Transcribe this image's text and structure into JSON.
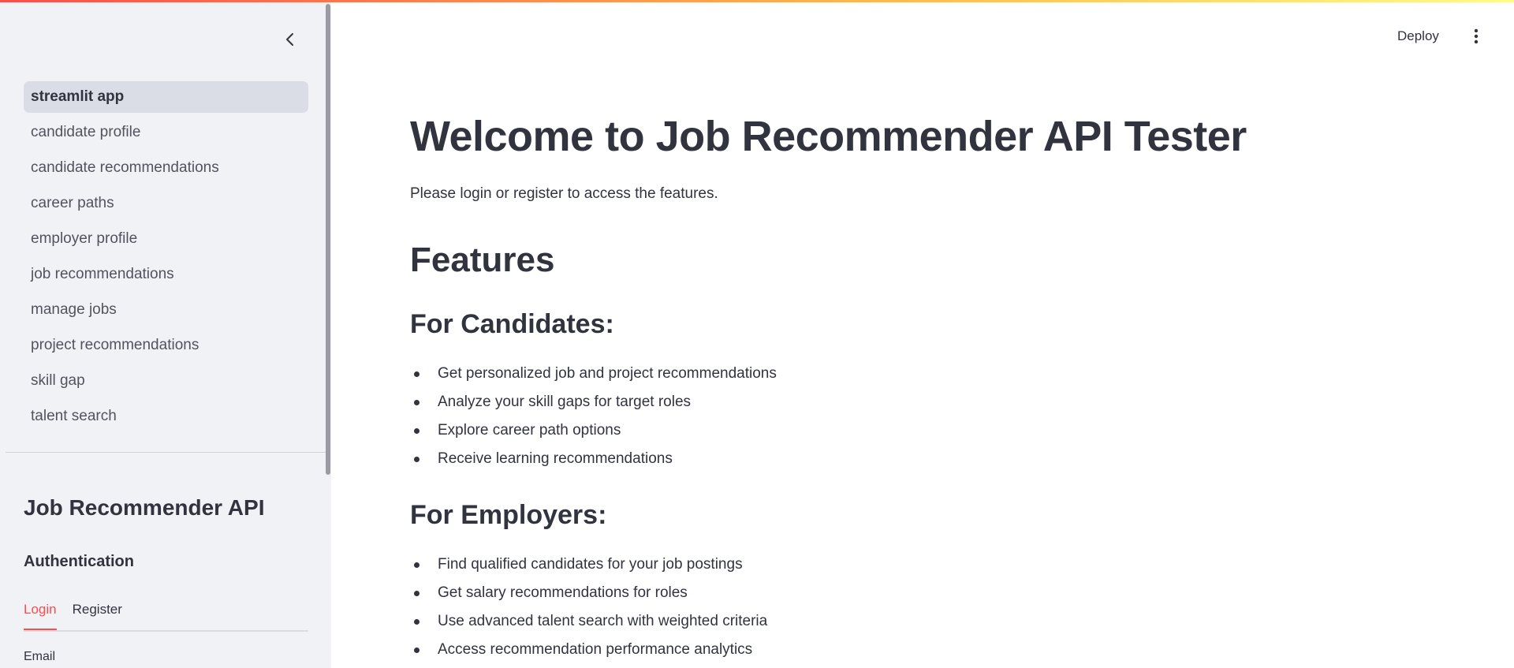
{
  "sidebar": {
    "nav_items": [
      {
        "label": "streamlit app",
        "active": true
      },
      {
        "label": "candidate profile"
      },
      {
        "label": "candidate recommendations"
      },
      {
        "label": "career paths"
      },
      {
        "label": "employer profile"
      },
      {
        "label": "job recommendations"
      },
      {
        "label": "manage jobs"
      },
      {
        "label": "project recommendations"
      },
      {
        "label": "skill gap"
      },
      {
        "label": "talent search"
      }
    ],
    "title": "Job Recommender API",
    "subtitle": "Authentication",
    "tabs": [
      {
        "label": "Login",
        "active": true
      },
      {
        "label": "Register"
      }
    ],
    "email_label": "Email",
    "collapse_icon": "chevron-left-icon"
  },
  "header": {
    "deploy_label": "Deploy",
    "menu_icon": "kebab-menu-icon"
  },
  "main": {
    "title": "Welcome to Job Recommender API Tester",
    "intro": "Please login or register to access the features.",
    "features_heading": "Features",
    "candidates": {
      "heading": "For Candidates:",
      "items": [
        "Get personalized job and project recommendations",
        "Analyze your skill gaps for target roles",
        "Explore career path options",
        "Receive learning recommendations"
      ]
    },
    "employers": {
      "heading": "For Employers:",
      "items": [
        "Find qualified candidates for your job postings",
        "Get salary recommendations for roles",
        "Use advanced talent search with weighted criteria",
        "Access recommendation performance analytics"
      ]
    }
  },
  "colors": {
    "accent": "#ff4b4b",
    "sidebar_bg": "#f0f2f6",
    "active_nav_bg": "#dadde5",
    "text": "#31333f"
  }
}
